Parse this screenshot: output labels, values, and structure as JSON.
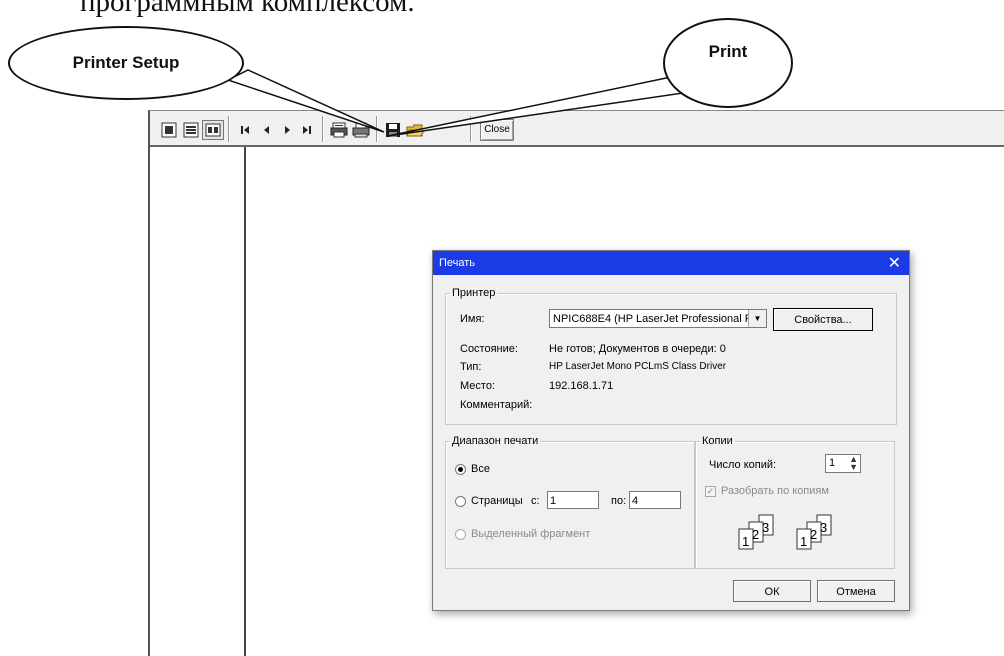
{
  "page_text": "программным комплексом.",
  "callouts": {
    "printer_setup": "Printer Setup",
    "print": "Print"
  },
  "toolbar": {
    "close_label": "Close"
  },
  "dialog": {
    "title": "Печать",
    "close_glyph": "✕",
    "printer_group": {
      "legend": "Принтер",
      "name_label": "Имя:",
      "name_value": "NPIC688E4 (HP LaserJet Professional P",
      "properties_button": "Свойства...",
      "status_label": "Состояние:",
      "status_value": "Не готов; Документов в очереди: 0",
      "type_label": "Тип:",
      "type_value": "HP LaserJet Mono PCLmS Class Driver",
      "location_label": "Место:",
      "location_value": "192.168.1.71",
      "comment_label": "Комментарий:"
    },
    "range_group": {
      "legend": "Диапазон печати",
      "all_label": "Все",
      "pages_label": "Страницы",
      "from_label": "с:",
      "from_value": "1",
      "to_label": "по:",
      "to_value": "4",
      "selection_label": "Выделенный фрагмент",
      "selected_option": "all"
    },
    "copies_group": {
      "legend": "Копии",
      "count_label": "Число копий:",
      "count_value": "1",
      "collate_label": "Разобрать по копиям",
      "collate_checked": true
    },
    "ok_button": "ОК",
    "cancel_button": "Отмена"
  },
  "colors": {
    "title_bar": "#1a3be6"
  }
}
